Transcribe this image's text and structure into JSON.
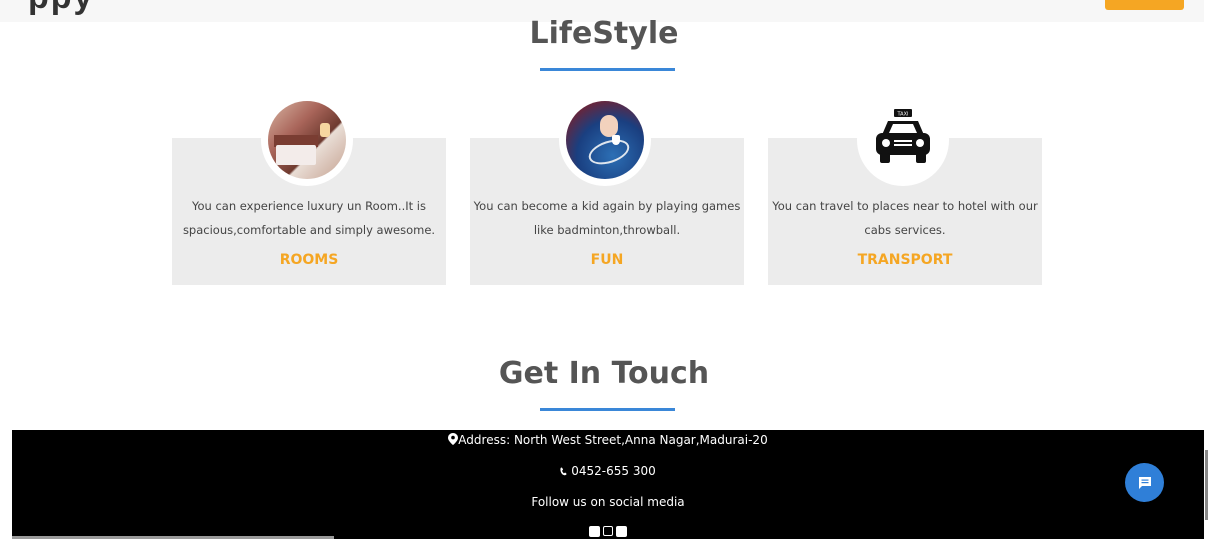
{
  "header": {
    "brand_fragment": "ppy"
  },
  "lifestyle": {
    "title": "LifeStyle",
    "cards": [
      {
        "image_icon": "hotel-room-image",
        "text_line1": "You can experience luxury un Room..It is",
        "text_line2": "spacious,comfortable and simply awesome.",
        "label": "ROOMS"
      },
      {
        "image_icon": "badminton-image",
        "text_line1": "You can become a kid again by playing games",
        "text_line2": "like badminton,throwball.",
        "label": "FUN"
      },
      {
        "image_icon": "taxi-icon",
        "text_line1": "You can travel to places near to hotel with our",
        "text_line2": "cabs services.",
        "label": "TRANSPORT"
      }
    ],
    "taxi_sign": "TAXI"
  },
  "contact": {
    "title": "Get In Touch",
    "address": "Address: North West Street,Anna Nagar,Madurai-20",
    "phone": "0452-655 300",
    "social_heading": "Follow us on social media",
    "social_icons": [
      "facebook-icon",
      "instagram-icon",
      "twitter-icon"
    ]
  },
  "colors": {
    "accent_orange": "#f5a623",
    "accent_blue": "#3a87d8",
    "footer_bg": "#000000",
    "card_bg": "#ececec"
  }
}
